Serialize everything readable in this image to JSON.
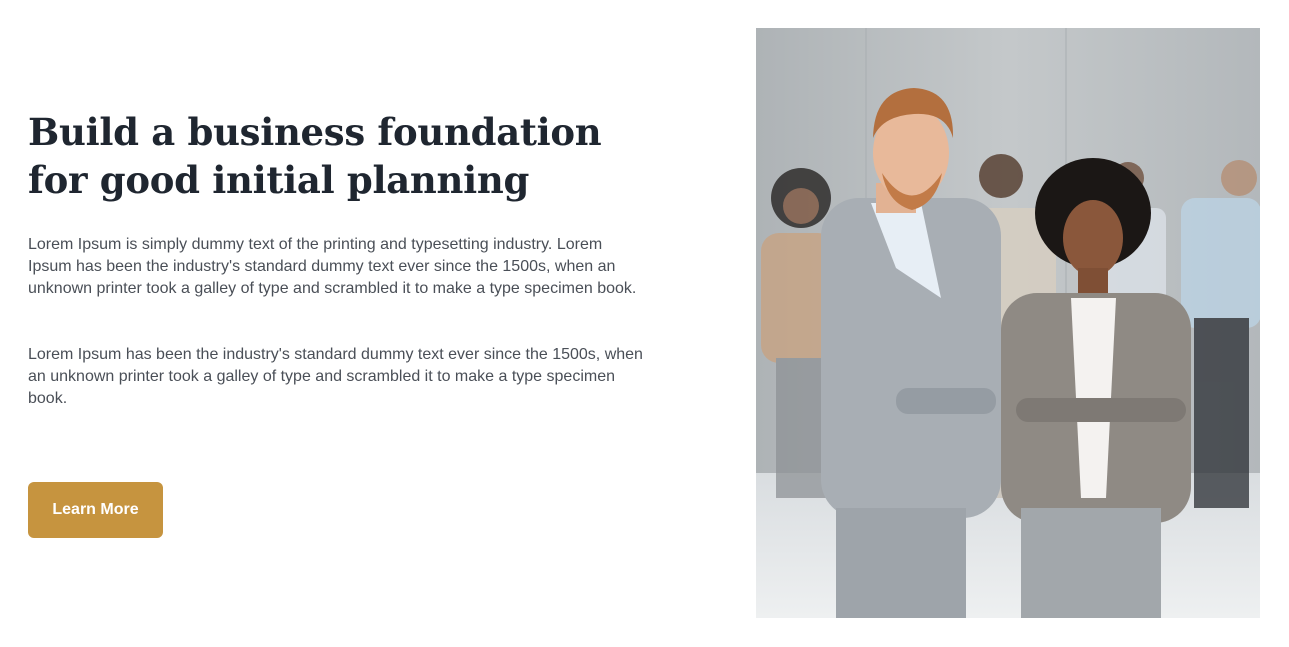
{
  "hero": {
    "headline": "Build a business foundation for good initial planning",
    "paragraph_1": "Lorem Ipsum is simply dummy text of the printing and typesetting industry. Lorem Ipsum has been the industry's standard dummy text ever since the 1500s, when an unknown printer took a galley of type and scrambled it to make a type specimen book.",
    "paragraph_2": "Lorem Ipsum has been the industry's standard dummy text ever since the 1500s, when an unknown printer took a galley of type and scrambled it to make a type specimen book.",
    "cta_label": "Learn More"
  },
  "colors": {
    "heading": "#1f2630",
    "body_text": "#4a4f57",
    "accent": "#c6943f"
  },
  "photo": {
    "icon": "team-photo"
  }
}
